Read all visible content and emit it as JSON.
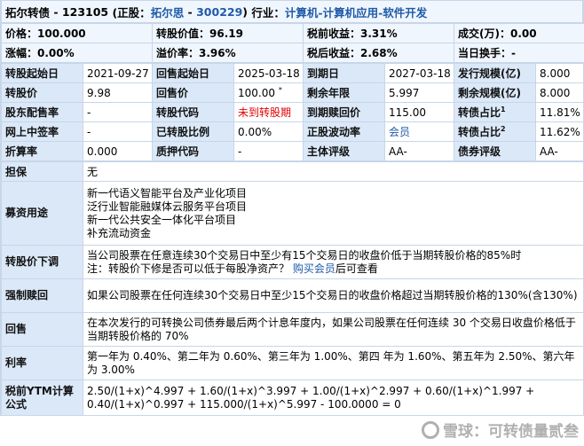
{
  "header": {
    "bond_name": "拓尔转债",
    "bond_code": "123105",
    "stock_prefix": "(正股：",
    "stock_name": "拓尔思",
    "stock_code": "300229",
    "industry_label": "行业：",
    "industry_value": "计算机-计算机应用-软件开发"
  },
  "quote": [
    [
      "价格：100.000",
      "转股价值：96.19",
      "税前收益：3.31%",
      "成交(万)：0.00"
    ],
    [
      "涨幅：0.00%",
      "溢价率：3.96%",
      "税后收益：2.68%",
      "当日换手：-"
    ]
  ],
  "grid": [
    [
      "转股起始日",
      "2021-09-27",
      "回售起始日",
      "2025-03-18",
      "到期日",
      "2027-03-18",
      "发行规模(亿)",
      "8.000"
    ],
    [
      "转股价",
      "9.98",
      "回售价",
      "100.00 *",
      "剩余年限",
      "5.997",
      "剩余规模(亿)",
      "8.000"
    ],
    [
      "股东配售率",
      "-",
      "转股代码",
      "未到转股期",
      "到期赎回价",
      "115.00",
      "转债占比1",
      "11.81%"
    ],
    [
      "网上中签率",
      "-",
      "已转股比例",
      "0.00%",
      "正股波动率",
      "会员",
      "转债占比2",
      "11.62%"
    ],
    [
      "折算率",
      "0.000",
      "质押代码",
      "-",
      "主体评级",
      "AA-",
      "债券评级",
      "AA-"
    ]
  ],
  "details": {
    "guarantee_label": "担保",
    "guarantee_value": "无",
    "fund_use_label": "募资用途",
    "fund_use_lines": [
      "新一代语义智能平台及产业化项目",
      "泛行业智能融媒体云服务平台项目",
      "新一代公共安全一体化平台项目",
      "补充流动资金"
    ],
    "downward_label": "转股价下调",
    "downward_line1": "当公司股票在任意连续30个交易日中至少有15个交易日的收盘价低于当期转股价格的85%时",
    "downward_note_prefix": "注：转股价下修是否可以低于每股净资产？",
    "downward_link": "购买会员",
    "downward_note_suffix": "后可查看",
    "redeem_label": "强制赎回",
    "redeem_text": "如果公司股票在任何连续30个交易日中至少15个交易日的收盘价格超过当期转股价格的130%(含130%)",
    "putback_label": "回售",
    "putback_text": "在本次发行的可转换公司债券最后两个计息年度内，如果公司股票在任何连续 30 个交易日收盘价格低于当期转股价格的 70%",
    "rate_label": "利率",
    "rate_text": "第一年为 0.40%、第二年为 0.60%、第三年为 1.00%、第四 年为 1.60%、第五年为 2.50%、第六年为 3.00%",
    "ytm_label": "税前YTM计算公式",
    "ytm_text": "2.50/(1+x)^4.997 + 1.60/(1+x)^3.997 + 1.00/(1+x)^2.997 + 0.60/(1+x)^1.997 + 0.40/(1+x)^0.997 + 115.000/(1+x)^5.997 - 100.0000 = 0"
  },
  "watermark": "雪球：可转债量贰叁",
  "colors": {
    "label_bg": "#dbe8f8",
    "border": "#c7d6e8",
    "link_blue": "#1f5aa8",
    "alert_red": "#e00000"
  }
}
